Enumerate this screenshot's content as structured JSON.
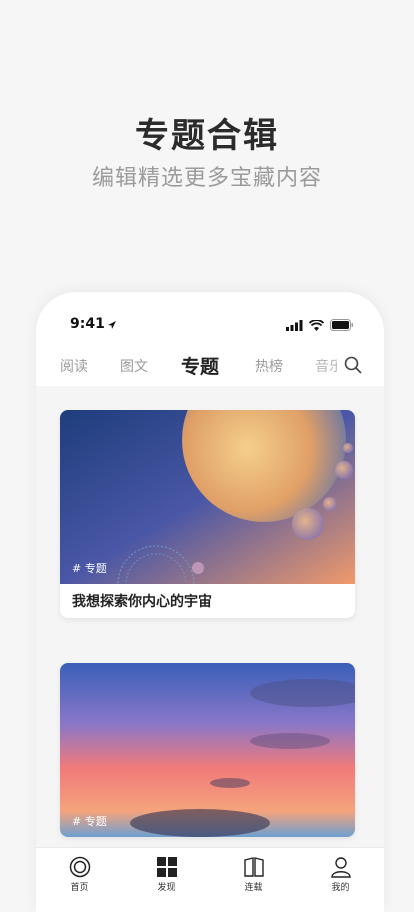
{
  "hero": {
    "title": "专题合辑",
    "subtitle": "编辑精选更多宝藏内容"
  },
  "status_bar": {
    "time": "9:41"
  },
  "tabs": [
    {
      "label": "阅读",
      "active": false
    },
    {
      "label": "图文",
      "active": false
    },
    {
      "label": "专题",
      "active": true
    },
    {
      "label": "热榜",
      "active": false
    },
    {
      "label": "音乐",
      "active": false
    }
  ],
  "cards": [
    {
      "tag": "# 专题",
      "title": "我想探索你内心的宇宙"
    },
    {
      "tag": "# 专题",
      "title": ""
    }
  ],
  "tabbar": [
    {
      "label": "首页",
      "icon": "home-ring-icon"
    },
    {
      "label": "发现",
      "icon": "grid-icon"
    },
    {
      "label": "连载",
      "icon": "book-icon"
    },
    {
      "label": "我的",
      "icon": "user-icon"
    }
  ],
  "colors": {
    "accent": "#222222",
    "muted": "#9a9a9a",
    "background": "#f6f6f6"
  }
}
